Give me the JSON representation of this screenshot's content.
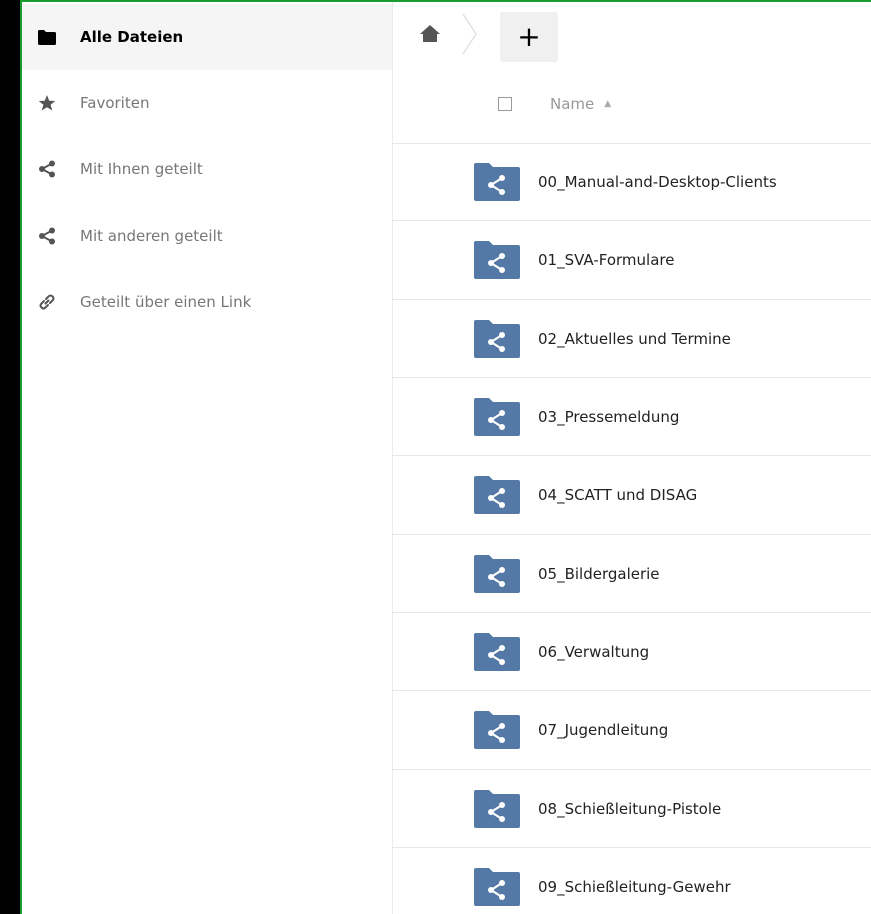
{
  "sidebar": {
    "items": [
      {
        "label": "Alle Dateien",
        "icon": "folder-icon",
        "active": true
      },
      {
        "label": "Favoriten",
        "icon": "star-icon"
      },
      {
        "label": "Mit Ihnen geteilt",
        "icon": "share-icon"
      },
      {
        "label": "Mit anderen geteilt",
        "icon": "share-icon"
      },
      {
        "label": "Geteilt über einen Link",
        "icon": "link-icon"
      }
    ]
  },
  "controls": {
    "home_icon": "home-icon",
    "add_label": "+"
  },
  "table": {
    "name_header": "Name",
    "sort_indicator": "▲"
  },
  "files": [
    {
      "name": "00_Manual-and-Desktop-Clients"
    },
    {
      "name": "01_SVA-Formulare"
    },
    {
      "name": "02_Aktuelles und Termine"
    },
    {
      "name": "03_Pressemeldung"
    },
    {
      "name": "04_SCATT und DISAG"
    },
    {
      "name": "05_Bildergalerie"
    },
    {
      "name": "06_Verwaltung"
    },
    {
      "name": "07_Jugendleitung"
    },
    {
      "name": "08_Schießleitung-Pistole"
    },
    {
      "name": "09_Schießleitung-Gewehr"
    }
  ],
  "colors": {
    "accent_border": "#1a9c32",
    "folder_blue": "#5579a6"
  }
}
